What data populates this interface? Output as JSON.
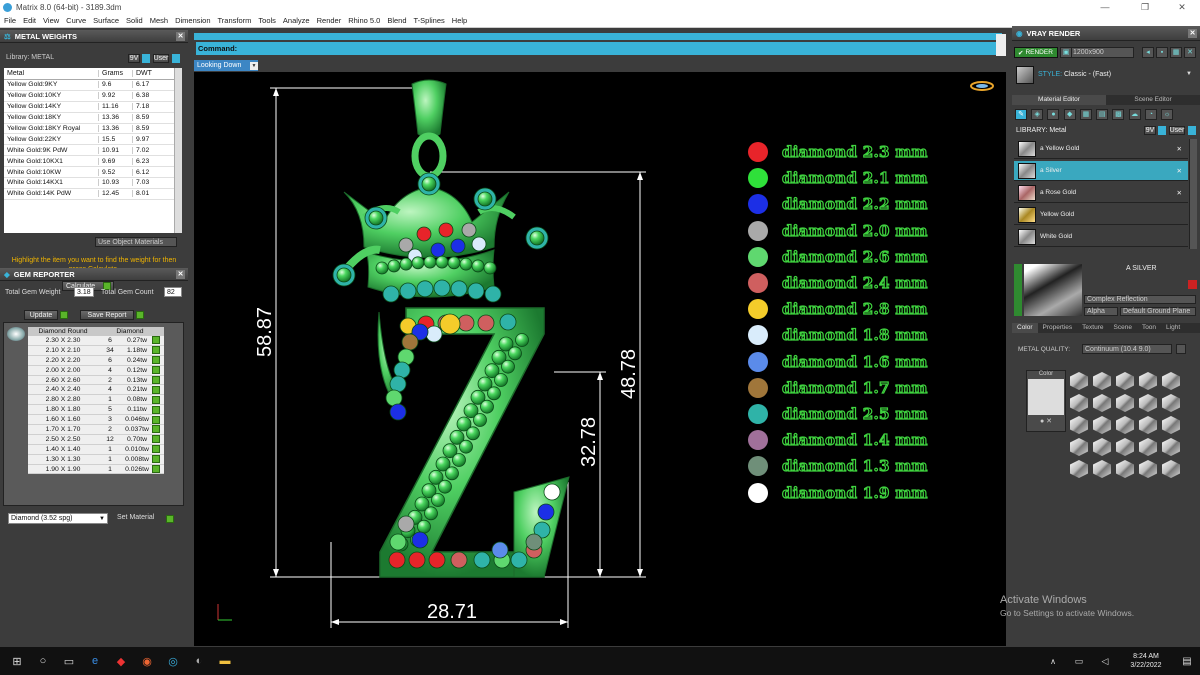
{
  "window": {
    "title": "Matrix 8.0 (64-bit) - 3189.3dm"
  },
  "menu": [
    "File",
    "Edit",
    "View",
    "Curve",
    "Surface",
    "Solid",
    "Mesh",
    "Dimension",
    "Transform",
    "Tools",
    "Analyze",
    "Render",
    "Rhino 5.0",
    "Blend",
    "T-Splines",
    "Help"
  ],
  "metal_weights": {
    "title": "METAL WEIGHTS",
    "library_label": "Library: METAL",
    "btn_9v": "9V",
    "btn_user": "User",
    "headers": [
      "Metal",
      "Grams",
      "DWT"
    ],
    "rows": [
      [
        "Yellow Gold:9KY",
        "9.6",
        "6.17"
      ],
      [
        "Yellow Gold:10KY",
        "9.92",
        "6.38"
      ],
      [
        "Yellow Gold:14KY",
        "11.16",
        "7.18"
      ],
      [
        "Yellow Gold:18KY",
        "13.36",
        "8.59"
      ],
      [
        "Yellow Gold:18KY Royal",
        "13.36",
        "8.59"
      ],
      [
        "Yellow Gold:22KY",
        "15.5",
        "9.97"
      ],
      [
        "White Gold:9K PdW",
        "10.91",
        "7.02"
      ],
      [
        "White Gold:10KX1",
        "9.69",
        "6.23"
      ],
      [
        "White Gold:10KW",
        "9.52",
        "6.12"
      ],
      [
        "White Gold:14KX1",
        "10.93",
        "7.03"
      ],
      [
        "White Gold:14K PdW",
        "12.45",
        "8.01"
      ]
    ],
    "use_object_materials": "Use Object Materials",
    "hint": "Highlight the item you want to find the weight for then press Calculate.",
    "calculate": "Calculate"
  },
  "gem_reporter": {
    "title": "GEM REPORTER",
    "total_weight_label": "Total Gem Weight",
    "total_weight": "3.18",
    "total_count_label": "Total Gem Count",
    "total_count": "82",
    "update": "Update",
    "save_report": "Save Report",
    "headers": [
      "Diamond Round",
      "Diamond"
    ],
    "rows": [
      [
        "2.30 X 2.30",
        "6",
        "0.27tw"
      ],
      [
        "2.10 X 2.10",
        "34",
        "1.18tw"
      ],
      [
        "2.20 X 2.20",
        "6",
        "0.24tw"
      ],
      [
        "2.00 X 2.00",
        "4",
        "0.12tw"
      ],
      [
        "2.60 X 2.60",
        "2",
        "0.13tw"
      ],
      [
        "2.40 X 2.40",
        "4",
        "0.21tw"
      ],
      [
        "2.80 X 2.80",
        "1",
        "0.08tw"
      ],
      [
        "1.80 X 1.80",
        "5",
        "0.11tw"
      ],
      [
        "1.60 X 1.60",
        "3",
        "0.046tw"
      ],
      [
        "1.70 X 1.70",
        "2",
        "0.037tw"
      ],
      [
        "2.50 X 2.50",
        "12",
        "0.70tw"
      ],
      [
        "1.40 X 1.40",
        "1",
        "0.010tw"
      ],
      [
        "1.30 X 1.30",
        "1",
        "0.008tw"
      ],
      [
        "1.90 X 1.90",
        "1",
        "0.026tw"
      ]
    ],
    "material_select": "Diamond    (3.52 spg)",
    "set_material": "Set Material"
  },
  "command": {
    "label": "Command:"
  },
  "viewport": {
    "view_name": "Looking Down",
    "dim_height": "58.87",
    "dim_inner": "48.78",
    "dim_lower": "32.78",
    "dim_width": "28.71",
    "legend": [
      {
        "color": "#e8242a",
        "label": "diamond 2.3 mm"
      },
      {
        "color": "#2fe03a",
        "label": "diamond 2.1 mm"
      },
      {
        "color": "#1c2fe6",
        "label": "diamond 2.2 mm"
      },
      {
        "color": "#a9a9a9",
        "label": "diamond 2.0 mm"
      },
      {
        "color": "#5fd86f",
        "label": "diamond 2.6 mm"
      },
      {
        "color": "#cf5f5f",
        "label": "diamond 2.4 mm"
      },
      {
        "color": "#f4cc2a",
        "label": "diamond 2.8 mm"
      },
      {
        "color": "#d9ecfb",
        "label": "diamond 1.8 mm"
      },
      {
        "color": "#5b8bea",
        "label": "diamond 1.6 mm"
      },
      {
        "color": "#a0763a",
        "label": "diamond 1.7 mm"
      },
      {
        "color": "#2fb3a8",
        "label": "diamond 2.5 mm"
      },
      {
        "color": "#a0709a",
        "label": "diamond 1.4 mm"
      },
      {
        "color": "#6f8f79",
        "label": "diamond 1.3 mm"
      },
      {
        "color": "#ffffff",
        "label": "diamond 1.9 mm"
      }
    ]
  },
  "vray": {
    "title": "VRAY RENDER",
    "render_btn": "RENDER",
    "resolution": "1200x900",
    "style_label": "STYLE:",
    "style_value": "Classic - (Fast)",
    "tabs": [
      "Material Editor",
      "Scene Editor"
    ],
    "library_label": "LIBRARY: Metal",
    "materials": [
      "a Yellow Gold",
      "a Silver",
      "a Rose Gold",
      "Yellow Gold",
      "White Gold"
    ],
    "selected_name": "A SILVER",
    "complex_reflection": "Complex Reflection",
    "alpha": "Alpha",
    "ground_plane": "Default Ground Plane",
    "prop_tabs": [
      "Color",
      "Properties",
      "Texture",
      "Scene",
      "Toon",
      "Light"
    ],
    "metal_quality_label": "METAL QUALITY:",
    "metal_quality_value": "Continuum        (10.4 9.0)",
    "color_label": "Color"
  },
  "activate": {
    "line1": "Activate Windows",
    "line2": "Go to Settings to activate Windows."
  },
  "taskbar": {
    "time": "8:24 AM",
    "date": "3/22/2022"
  }
}
